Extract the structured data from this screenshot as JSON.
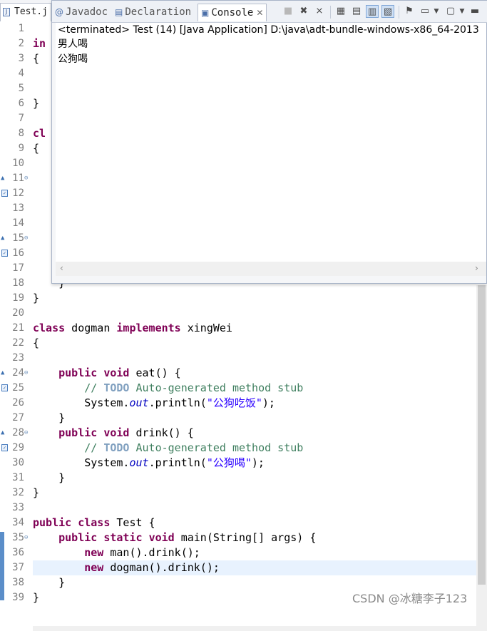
{
  "editor": {
    "tab_label": "Test.j",
    "lines": [
      {
        "n": "1",
        "html": ""
      },
      {
        "n": "2",
        "html": "<span class='kw'>in</span>"
      },
      {
        "n": "3",
        "html": "{"
      },
      {
        "n": "4",
        "html": ""
      },
      {
        "n": "5",
        "html": ""
      },
      {
        "n": "6",
        "html": "}"
      },
      {
        "n": "7",
        "html": ""
      },
      {
        "n": "8",
        "html": "<span class='kw'>cl</span>"
      },
      {
        "n": "9",
        "html": "{"
      },
      {
        "n": "10",
        "html": ""
      },
      {
        "n": "11",
        "html": ""
      },
      {
        "n": "12",
        "html": ""
      },
      {
        "n": "13",
        "html": ""
      },
      {
        "n": "14",
        "html": ""
      },
      {
        "n": "15",
        "html": ""
      },
      {
        "n": "16",
        "html": ""
      },
      {
        "n": "17",
        "html": ""
      },
      {
        "n": "18",
        "html": "    }"
      },
      {
        "n": "19",
        "html": "}"
      },
      {
        "n": "20",
        "html": ""
      },
      {
        "n": "21",
        "html": "<span class='kw'>class</span> dogman <span class='kw'>implements</span> xingWei"
      },
      {
        "n": "22",
        "html": "{"
      },
      {
        "n": "23",
        "html": ""
      },
      {
        "n": "24",
        "html": "    <span class='kw'>public</span> <span class='kw'>void</span> eat() {"
      },
      {
        "n": "25",
        "html": "        <span class='cm'>// </span><span class='todo'>TODO</span><span class='cm'> Auto-generated method stub</span>"
      },
      {
        "n": "26",
        "html": "        System.<span class='fld'>out</span>.println(<span class='st'>\"公狗吃饭\"</span>);"
      },
      {
        "n": "27",
        "html": "    }"
      },
      {
        "n": "28",
        "html": "    <span class='kw'>public</span> <span class='kw'>void</span> drink() {"
      },
      {
        "n": "29",
        "html": "        <span class='cm'>// </span><span class='todo'>TODO</span><span class='cm'> Auto-generated method stub</span>"
      },
      {
        "n": "30",
        "html": "        System.<span class='fld'>out</span>.println(<span class='st'>\"公狗喝\"</span>);"
      },
      {
        "n": "31",
        "html": "    }"
      },
      {
        "n": "32",
        "html": "}"
      },
      {
        "n": "33",
        "html": ""
      },
      {
        "n": "34",
        "html": "<span class='kw'>public</span> <span class='kw'>class</span> Test {"
      },
      {
        "n": "35",
        "html": "    <span class='kw'>public</span> <span class='kw'>static</span> <span class='kw'>void</span> main(String[] args) {"
      },
      {
        "n": "36",
        "html": "        <span class='kw'>new</span> man().drink();"
      },
      {
        "n": "37",
        "html": "        <span class='kw'>new</span> dogman().drink();"
      },
      {
        "n": "38",
        "html": "    }"
      },
      {
        "n": "39",
        "html": "}"
      }
    ],
    "override_lines": [
      "11",
      "15",
      "24",
      "28"
    ],
    "implements_lines": [
      "12",
      "16",
      "25",
      "29"
    ],
    "fold_lines": [
      "11",
      "15",
      "24",
      "28",
      "35"
    ],
    "current_line": "37"
  },
  "console_view": {
    "tabs": {
      "javadoc": "Javadoc",
      "declaration": "Declaration",
      "console": "Console"
    },
    "terminated": "<terminated> Test (14) [Java Application] D:\\java\\adt-bundle-windows-x86_64-2013",
    "output": [
      "男人喝",
      "公狗喝"
    ]
  },
  "icons": {
    "terminate": "terminate-icon",
    "remove_launch": "remove-launch-icon",
    "remove_all": "remove-all-terminated-icon",
    "clear": "clear-console-icon",
    "scroll_lock": "scroll-lock-icon",
    "show_stdout": "show-on-stdout-icon",
    "show_stderr": "show-on-stderr-icon",
    "pin": "pin-console-icon",
    "display": "display-console-icon",
    "open": "open-console-icon"
  },
  "watermark": "CSDN @冰糖李子123"
}
